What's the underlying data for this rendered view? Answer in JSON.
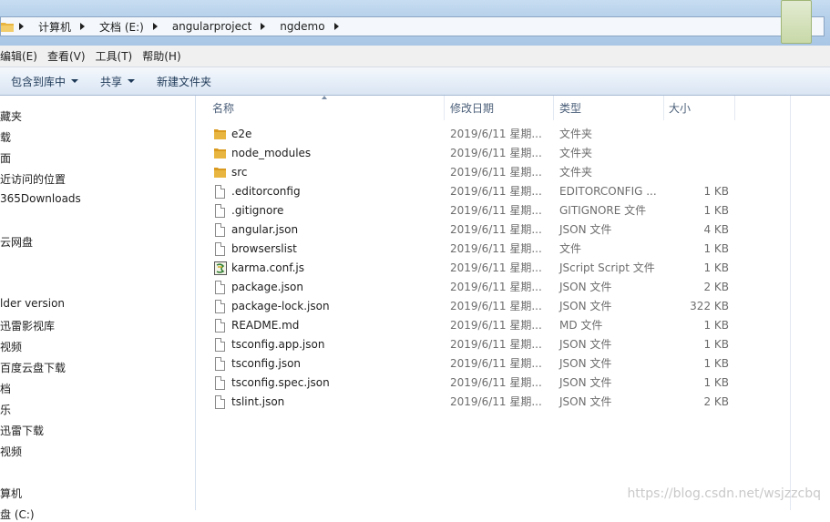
{
  "address_bar": {
    "breadcrumbs": [
      "计算机",
      "文档 (E:)",
      "angularproject",
      "ngdemo"
    ]
  },
  "menu": {
    "items": [
      "编辑(E)",
      "查看(V)",
      "工具(T)",
      "帮助(H)"
    ]
  },
  "command_bar": {
    "include_library": "包含到库中",
    "share": "共享",
    "new_folder": "新建文件夹"
  },
  "nav": {
    "items": [
      "藏夹",
      "载",
      "面",
      "近访问的位置",
      "365Downloads",
      "",
      "云网盘",
      "",
      "",
      "lder version",
      "迅雷影视库",
      "视频",
      "百度云盘下载",
      "档",
      "乐",
      "迅雷下载",
      "视频",
      "",
      "算机",
      "盘 (C:)"
    ]
  },
  "columns": {
    "name": "名称",
    "date": "修改日期",
    "type": "类型",
    "size": "大小"
  },
  "files": [
    {
      "name": "e2e",
      "date": "2019/6/11 星期...",
      "type": "文件夹",
      "size": "",
      "icon": "folder-icon"
    },
    {
      "name": "node_modules",
      "date": "2019/6/11 星期...",
      "type": "文件夹",
      "size": "",
      "icon": "folder-icon"
    },
    {
      "name": "src",
      "date": "2019/6/11 星期...",
      "type": "文件夹",
      "size": "",
      "icon": "folder-icon"
    },
    {
      "name": ".editorconfig",
      "date": "2019/6/11 星期...",
      "type": "EDITORCONFIG ...",
      "size": "1 KB",
      "icon": "file-icon"
    },
    {
      "name": ".gitignore",
      "date": "2019/6/11 星期...",
      "type": "GITIGNORE 文件",
      "size": "1 KB",
      "icon": "file-icon"
    },
    {
      "name": "angular.json",
      "date": "2019/6/11 星期...",
      "type": "JSON 文件",
      "size": "4 KB",
      "icon": "file-icon"
    },
    {
      "name": "browserslist",
      "date": "2019/6/11 星期...",
      "type": "文件",
      "size": "1 KB",
      "icon": "file-icon"
    },
    {
      "name": "karma.conf.js",
      "date": "2019/6/11 星期...",
      "type": "JScript Script 文件",
      "size": "1 KB",
      "icon": "script-icon"
    },
    {
      "name": "package.json",
      "date": "2019/6/11 星期...",
      "type": "JSON 文件",
      "size": "2 KB",
      "icon": "file-icon"
    },
    {
      "name": "package-lock.json",
      "date": "2019/6/11 星期...",
      "type": "JSON 文件",
      "size": "322 KB",
      "icon": "file-icon"
    },
    {
      "name": "README.md",
      "date": "2019/6/11 星期...",
      "type": "MD 文件",
      "size": "1 KB",
      "icon": "file-icon"
    },
    {
      "name": "tsconfig.app.json",
      "date": "2019/6/11 星期...",
      "type": "JSON 文件",
      "size": "1 KB",
      "icon": "file-icon"
    },
    {
      "name": "tsconfig.json",
      "date": "2019/6/11 星期...",
      "type": "JSON 文件",
      "size": "1 KB",
      "icon": "file-icon"
    },
    {
      "name": "tsconfig.spec.json",
      "date": "2019/6/11 星期...",
      "type": "JSON 文件",
      "size": "1 KB",
      "icon": "file-icon"
    },
    {
      "name": "tslint.json",
      "date": "2019/6/11 星期...",
      "type": "JSON 文件",
      "size": "2 KB",
      "icon": "file-icon"
    }
  ],
  "watermark": "https://blog.csdn.net/wsjzzcbq",
  "colors": {
    "folder": "#e8b640",
    "header_text": "#4c607a",
    "detail_text": "#6d6d6d"
  }
}
